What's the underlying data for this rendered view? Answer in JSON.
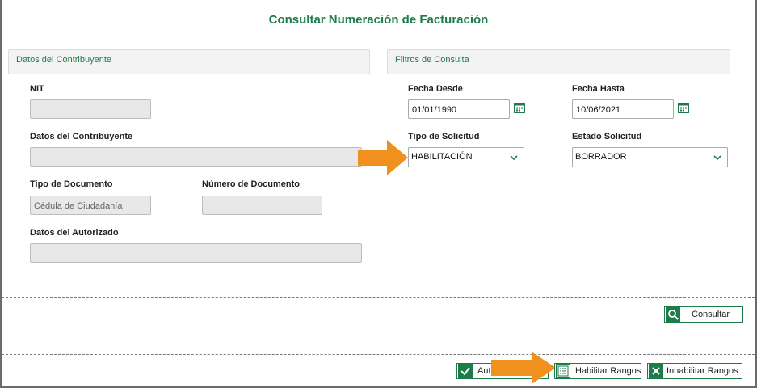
{
  "page": {
    "title": "Consultar Numeración de Facturación"
  },
  "contribuyente": {
    "section_title": "Datos del Contribuyente",
    "nit_label": "NIT",
    "nit_value": "",
    "datos_label": "Datos del Contribuyente",
    "datos_value": "",
    "tipo_doc_label": "Tipo de Documento",
    "tipo_doc_value": "Cédula de Ciudadanía",
    "numero_doc_label": "Número de Documento",
    "numero_doc_value": "",
    "autorizado_label": "Datos del Autorizado",
    "autorizado_value": ""
  },
  "filtros": {
    "section_title": "Filtros de Consulta",
    "fecha_desde_label": "Fecha Desde",
    "fecha_desde_value": "01/01/1990",
    "fecha_hasta_label": "Fecha Hasta",
    "fecha_hasta_value": "10/06/2021",
    "tipo_solicitud_label": "Tipo de Solicitud",
    "tipo_solicitud_value": "HABILITACIÓN",
    "estado_solicitud_label": "Estado Solicitud",
    "estado_solicitud_value": "BORRADOR"
  },
  "actions": {
    "consultar_label": "Consultar",
    "autorizar_label": "Auto",
    "habilitar_label": "Habilitar Rangos",
    "inhabilitar_label": "Inhabilitar Rangos"
  },
  "icons": {
    "calendar": "calendar-icon",
    "chevron": "chevron-down-icon",
    "search": "search-icon",
    "check": "check-icon",
    "list": "list-icon",
    "close": "close-icon",
    "pointer": "orange-arrow"
  },
  "colors": {
    "accent": "#1e7b4a",
    "pointer": "#f0901e"
  }
}
